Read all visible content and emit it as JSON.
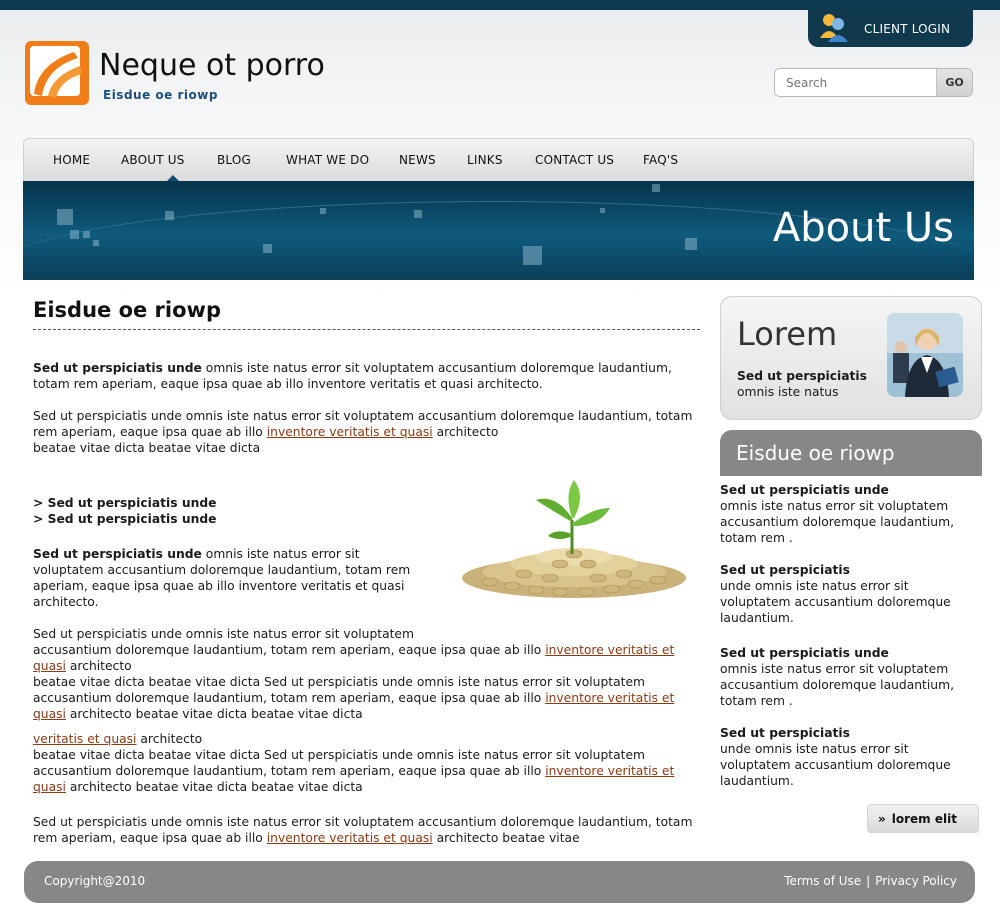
{
  "header": {
    "login_label": "CLIENT LOGIN",
    "site_title": "Neque ot porro",
    "site_tagline": "Eisdue oe riowp",
    "search": {
      "placeholder": "Search",
      "button": "GO"
    }
  },
  "nav": {
    "items": [
      "HOME",
      "ABOUT US",
      "BLOG",
      "WHAT WE DO",
      "NEWS",
      "LINKS",
      "CONTACT US",
      "FAQ'S"
    ],
    "active": "ABOUT US"
  },
  "banner": {
    "title": "About Us"
  },
  "main": {
    "title": "Eisdue oe riowp",
    "p1_bold": "Sed ut perspiciatis unde",
    "p1_rest": " omnis iste natus error sit voluptatem accusantium doloremque laudantium, totam rem aperiam, eaque ipsa quae ab illo inventore veritatis et quasi architecto.",
    "p2_text": "Sed ut perspiciatis unde omnis iste natus error sit voluptatem accusantium doloremque laudantium, totam rem aperiam, eaque ipsa quae ab illo ",
    "p2_link": "inventore veritatis et quasi",
    "p2_after": " architecto",
    "p2_line3": "beatae vitae dicta  beatae vitae dicta",
    "bullet1": "> Sed ut perspiciatis unde",
    "bullet2": "> Sed ut perspiciatis unde",
    "p3_bold": "Sed ut perspiciatis unde",
    "p3_rest": " omnis iste natus error sit voluptatem accusantium doloremque laudantium, totam rem aperiam, eaque ipsa quae ab illo inventore veritatis et quasi architecto.",
    "p4_line1": "Sed ut perspiciatis unde omnis iste natus error sit voluptatem",
    "p4_text": "accusantium doloremque laudantium, totam rem aperiam, eaque ipsa quae ab illo ",
    "p4_link": "inventore veritatis et quasi",
    "p4_after": " architecto",
    "p4_text2": "beatae vitae dicta  beatae vitae dicta Sed ut perspiciatis unde omnis iste natus error sit voluptatem accusantium doloremque laudantium, totam rem aperiam, eaque ipsa quae ab illo ",
    "p4_link2": "inventore veritatis et quasi",
    "p4_after2": " architecto beatae vitae dicta  beatae vitae dicta",
    "p5_link": "veritatis et quasi",
    "p5_after": " architecto",
    "p5_text": "beatae vitae dicta  beatae vitae dicta Sed ut perspiciatis unde omnis iste natus error sit voluptatem accusantium doloremque laudantium, totam rem aperiam, eaque ipsa quae ab illo ",
    "p5_link2": "inventore veritatis et quasi",
    "p5_after2": " architecto beatae vitae dicta  beatae vitae dicta",
    "p6_text": "Sed ut perspiciatis unde omnis iste natus error sit voluptatem accusantium doloremque laudantium, totam rem aperiam, eaque ipsa quae ab illo ",
    "p6_link": "inventore veritatis et quasi",
    "p6_after": " architecto beatae vitae"
  },
  "sidebar": {
    "box_title": "Lorem",
    "box_bold": "Sed ut perspiciatis",
    "box_text": "omnis iste natus",
    "section_title": "Eisdue oe riowp",
    "items": [
      {
        "title": "Sed ut perspiciatis unde",
        "text": "omnis iste natus error sit voluptatem accusantium doloremque laudantium, totam rem ."
      },
      {
        "title": "Sed ut perspiciatis",
        "text": "unde omnis iste natus error sit voluptatem accusantium doloremque laudantium."
      },
      {
        "title": "Sed ut perspiciatis unde",
        "text": "omnis iste natus error sit voluptatem accusantium doloremque laudantium, totam rem ."
      },
      {
        "title": "Sed ut perspiciatis",
        "text": "unde omnis iste natus error sit voluptatem accusantium doloremque laudantium."
      }
    ],
    "more_button": "lorem elit"
  },
  "footer": {
    "copyright": "Copyright@2010",
    "terms": "Terms of Use",
    "separator": "|",
    "privacy": "Privacy Policy"
  },
  "colors": {
    "accent": "#0f5a7c",
    "dark_bar": "#0e3a4f",
    "link": "#8a3a14",
    "gray_panel": "#878787"
  }
}
